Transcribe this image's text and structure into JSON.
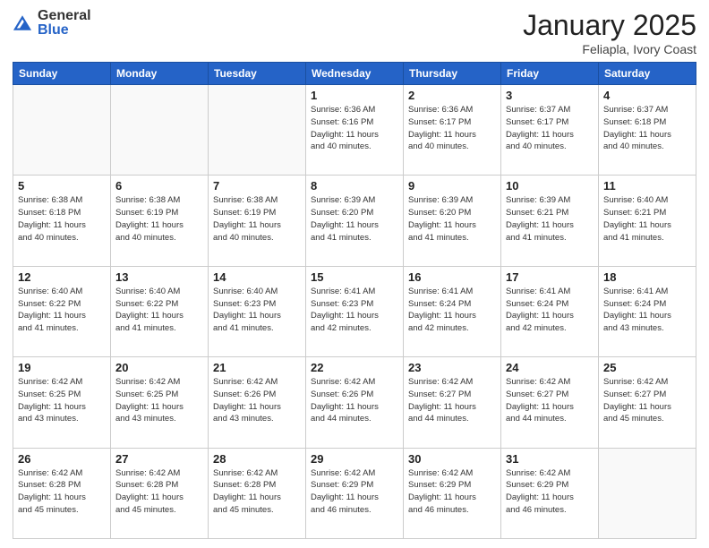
{
  "logo": {
    "general": "General",
    "blue": "Blue"
  },
  "header": {
    "month": "January 2025",
    "location": "Feliapla, Ivory Coast"
  },
  "weekdays": [
    "Sunday",
    "Monday",
    "Tuesday",
    "Wednesday",
    "Thursday",
    "Friday",
    "Saturday"
  ],
  "weeks": [
    [
      {
        "day": "",
        "info": ""
      },
      {
        "day": "",
        "info": ""
      },
      {
        "day": "",
        "info": ""
      },
      {
        "day": "1",
        "info": "Sunrise: 6:36 AM\nSunset: 6:16 PM\nDaylight: 11 hours\nand 40 minutes."
      },
      {
        "day": "2",
        "info": "Sunrise: 6:36 AM\nSunset: 6:17 PM\nDaylight: 11 hours\nand 40 minutes."
      },
      {
        "day": "3",
        "info": "Sunrise: 6:37 AM\nSunset: 6:17 PM\nDaylight: 11 hours\nand 40 minutes."
      },
      {
        "day": "4",
        "info": "Sunrise: 6:37 AM\nSunset: 6:18 PM\nDaylight: 11 hours\nand 40 minutes."
      }
    ],
    [
      {
        "day": "5",
        "info": "Sunrise: 6:38 AM\nSunset: 6:18 PM\nDaylight: 11 hours\nand 40 minutes."
      },
      {
        "day": "6",
        "info": "Sunrise: 6:38 AM\nSunset: 6:19 PM\nDaylight: 11 hours\nand 40 minutes."
      },
      {
        "day": "7",
        "info": "Sunrise: 6:38 AM\nSunset: 6:19 PM\nDaylight: 11 hours\nand 40 minutes."
      },
      {
        "day": "8",
        "info": "Sunrise: 6:39 AM\nSunset: 6:20 PM\nDaylight: 11 hours\nand 41 minutes."
      },
      {
        "day": "9",
        "info": "Sunrise: 6:39 AM\nSunset: 6:20 PM\nDaylight: 11 hours\nand 41 minutes."
      },
      {
        "day": "10",
        "info": "Sunrise: 6:39 AM\nSunset: 6:21 PM\nDaylight: 11 hours\nand 41 minutes."
      },
      {
        "day": "11",
        "info": "Sunrise: 6:40 AM\nSunset: 6:21 PM\nDaylight: 11 hours\nand 41 minutes."
      }
    ],
    [
      {
        "day": "12",
        "info": "Sunrise: 6:40 AM\nSunset: 6:22 PM\nDaylight: 11 hours\nand 41 minutes."
      },
      {
        "day": "13",
        "info": "Sunrise: 6:40 AM\nSunset: 6:22 PM\nDaylight: 11 hours\nand 41 minutes."
      },
      {
        "day": "14",
        "info": "Sunrise: 6:40 AM\nSunset: 6:23 PM\nDaylight: 11 hours\nand 41 minutes."
      },
      {
        "day": "15",
        "info": "Sunrise: 6:41 AM\nSunset: 6:23 PM\nDaylight: 11 hours\nand 42 minutes."
      },
      {
        "day": "16",
        "info": "Sunrise: 6:41 AM\nSunset: 6:24 PM\nDaylight: 11 hours\nand 42 minutes."
      },
      {
        "day": "17",
        "info": "Sunrise: 6:41 AM\nSunset: 6:24 PM\nDaylight: 11 hours\nand 42 minutes."
      },
      {
        "day": "18",
        "info": "Sunrise: 6:41 AM\nSunset: 6:24 PM\nDaylight: 11 hours\nand 43 minutes."
      }
    ],
    [
      {
        "day": "19",
        "info": "Sunrise: 6:42 AM\nSunset: 6:25 PM\nDaylight: 11 hours\nand 43 minutes."
      },
      {
        "day": "20",
        "info": "Sunrise: 6:42 AM\nSunset: 6:25 PM\nDaylight: 11 hours\nand 43 minutes."
      },
      {
        "day": "21",
        "info": "Sunrise: 6:42 AM\nSunset: 6:26 PM\nDaylight: 11 hours\nand 43 minutes."
      },
      {
        "day": "22",
        "info": "Sunrise: 6:42 AM\nSunset: 6:26 PM\nDaylight: 11 hours\nand 44 minutes."
      },
      {
        "day": "23",
        "info": "Sunrise: 6:42 AM\nSunset: 6:27 PM\nDaylight: 11 hours\nand 44 minutes."
      },
      {
        "day": "24",
        "info": "Sunrise: 6:42 AM\nSunset: 6:27 PM\nDaylight: 11 hours\nand 44 minutes."
      },
      {
        "day": "25",
        "info": "Sunrise: 6:42 AM\nSunset: 6:27 PM\nDaylight: 11 hours\nand 45 minutes."
      }
    ],
    [
      {
        "day": "26",
        "info": "Sunrise: 6:42 AM\nSunset: 6:28 PM\nDaylight: 11 hours\nand 45 minutes."
      },
      {
        "day": "27",
        "info": "Sunrise: 6:42 AM\nSunset: 6:28 PM\nDaylight: 11 hours\nand 45 minutes."
      },
      {
        "day": "28",
        "info": "Sunrise: 6:42 AM\nSunset: 6:28 PM\nDaylight: 11 hours\nand 45 minutes."
      },
      {
        "day": "29",
        "info": "Sunrise: 6:42 AM\nSunset: 6:29 PM\nDaylight: 11 hours\nand 46 minutes."
      },
      {
        "day": "30",
        "info": "Sunrise: 6:42 AM\nSunset: 6:29 PM\nDaylight: 11 hours\nand 46 minutes."
      },
      {
        "day": "31",
        "info": "Sunrise: 6:42 AM\nSunset: 6:29 PM\nDaylight: 11 hours\nand 46 minutes."
      },
      {
        "day": "",
        "info": ""
      }
    ]
  ]
}
